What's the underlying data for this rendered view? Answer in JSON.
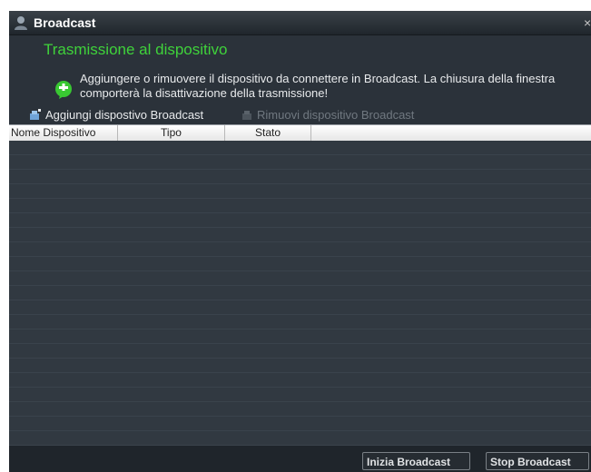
{
  "window": {
    "title": "Broadcast",
    "close_glyph": "×"
  },
  "heading": "Trasmissione al dispositivo",
  "info": {
    "icon": "info-bubble-icon",
    "text": "Aggiungere o rimuovere il dispositivo da connettere in Broadcast. La chiusura della finestra comporterà la disattivazione della trasmissione!"
  },
  "toolbar": {
    "add_label": "Aggiungi dispostivo Broadcast",
    "remove_label": "Rimuovi dispositivo Broadcast",
    "remove_enabled": false
  },
  "table": {
    "columns": [
      "Nome Dispositivo",
      "Tipo",
      "Stato"
    ],
    "rows": []
  },
  "buttons": {
    "start_label": "Inizia Broadcast",
    "stop_label": "Stop Broadcast"
  },
  "colors": {
    "heading": "#3fd23a",
    "background": "#2b323a",
    "info_icon": "#39c832"
  }
}
